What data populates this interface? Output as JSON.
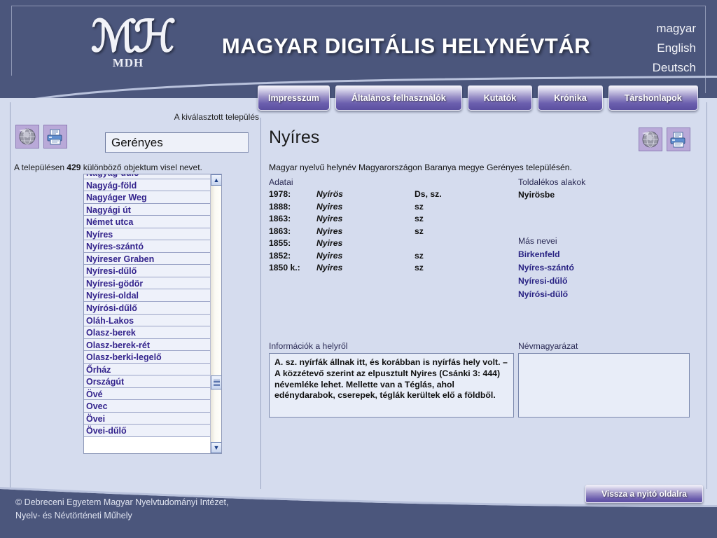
{
  "header": {
    "logo_monogram": "ℳℋ",
    "logo_sub": "MDH",
    "site_title": "MAGYAR DIGITÁLIS HELYNÉVTÁR",
    "languages": [
      "magyar",
      "English",
      "Deutsch"
    ]
  },
  "nav": {
    "tabs": [
      {
        "label": "Impresszum"
      },
      {
        "label": "Általános felhasználók"
      },
      {
        "label": "Kutatók"
      },
      {
        "label": "Krónika"
      },
      {
        "label": "Társhonlapok"
      }
    ]
  },
  "left_panel": {
    "icons": [
      {
        "name": "globe-map-icon"
      },
      {
        "name": "printer-icon"
      }
    ],
    "selected_town_label": "A kiválasztott település",
    "town_value": "Gerényes",
    "count_prefix": "A településen",
    "count_value": "429",
    "count_suffix": "különböző objektum visel nevet.",
    "list_items": [
      "Nagyág-dűlő",
      "Nagyág-föld",
      "Nagyáger Weg",
      "Nagyági út",
      "Német utca",
      "Nyíres",
      "Nyíres-szántó",
      "Nyireser Graben",
      "Nyíresi-dűlő",
      "Nyíresi-gödör",
      "Nyíresi-oldal",
      "Nyírósi-dűlő",
      "Oláh-Lakos",
      "Olasz-berek",
      "Olasz-berek-rét",
      "Olasz-berki-legelő",
      "Őrház",
      "Országút",
      "Övé",
      "Ovec",
      "Övei",
      "Övei-dűlő"
    ]
  },
  "main": {
    "title": "Nyíres",
    "icons": [
      {
        "name": "globe-map-icon"
      },
      {
        "name": "printer-icon"
      }
    ],
    "description": "Magyar nyelvű helynév Magyarországon Baranya megye Gerényes településén.",
    "adatai_label": "Adatai",
    "adatai_rows": [
      {
        "year": "1978:",
        "form": "Nyírös",
        "note": "Ds, sz."
      },
      {
        "year": "1888:",
        "form": "Nyires",
        "note": "sz"
      },
      {
        "year": "1863:",
        "form": "Nyires",
        "note": "sz"
      },
      {
        "year": "1863:",
        "form": "Nyires",
        "note": "sz"
      },
      {
        "year": "1855:",
        "form": "Nyires",
        "note": ""
      },
      {
        "year": "1852:",
        "form": "Nyires",
        "note": "sz"
      },
      {
        "year": "1850 k.:",
        "form": "Nyires",
        "note": "sz"
      }
    ],
    "toldalekos_label": "Toldalékos alakok",
    "toldalekos_value": "Nyirösbe",
    "masnevei_label": "Más nevei",
    "masnevei_items": [
      "Birkenfeld",
      "Nyíres-szántó",
      "Nyíresi-dűlő",
      "Nyírósi-dűlő"
    ],
    "info_label": "Információk a helyről",
    "info_text": "A. sz. nyírfák állnak itt, és korábban is nyírfás hely volt. – A közzétevő szerint az elpusztult Nyires (Csánki 3: 444) névemléke lehet. Mellette van a Téglás, ahol edénydarabok, cserepek, téglák kerültek elő a földből.",
    "nevmagyarazat_label": "Névmagyarázat",
    "nevmagyarazat_text": ""
  },
  "footer": {
    "copyright_line1": "© Debreceni Egyetem Magyar Nyelvtudományi Intézet,",
    "copyright_line2": "Nyelv- és Névtörténeti Műhely",
    "back_button": "Vissza a nyitó oldalra"
  },
  "colors": {
    "header_blue": "#4b567c",
    "page_bg": "#d5dcee",
    "link_purple": "#2a2484",
    "tab_purple": "#5b4fa0",
    "border_blue": "#8d98b8"
  }
}
